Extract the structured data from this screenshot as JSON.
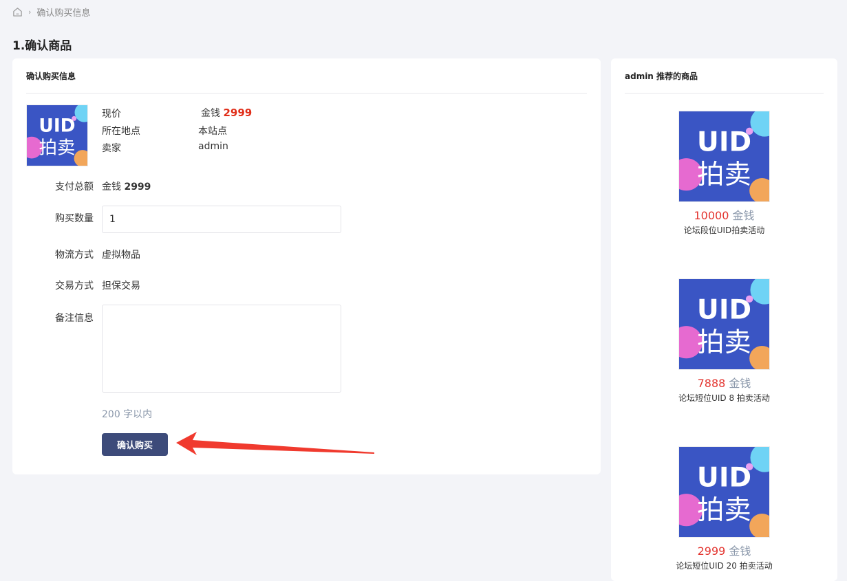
{
  "breadcrumb": {
    "current": "确认购买信息"
  },
  "page_title": "1.确认商品",
  "main": {
    "header": "确认购买信息",
    "item": {
      "image_text_top": "UID",
      "image_text_bottom": "拍卖",
      "price_label": "现价",
      "price_unit": "金钱",
      "price_value": "2999",
      "location_label": "所在地点",
      "location_value": "本站点",
      "seller_label": "卖家",
      "seller_value": "admin"
    },
    "form": {
      "total_label": "支付总额",
      "total_unit": "金钱",
      "total_value": "2999",
      "quantity_label": "购买数量",
      "quantity_value": "1",
      "logistics_label": "物流方式",
      "logistics_value": "虚拟物品",
      "trade_label": "交易方式",
      "trade_value": "担保交易",
      "remark_label": "备注信息",
      "remark_hint": "200 字以内",
      "confirm_label": "确认购买"
    }
  },
  "sidebar": {
    "header": "admin 推荐的商品",
    "items": [
      {
        "price": "10000",
        "unit": "金钱",
        "title": "论坛段位UID拍卖活动"
      },
      {
        "price": "7888",
        "unit": "金钱",
        "title": "论坛短位UID 8 拍卖活动"
      },
      {
        "price": "2999",
        "unit": "金钱",
        "title": "论坛短位UID 20 拍卖活动"
      }
    ]
  },
  "colors": {
    "accent_button": "#3d4b7a",
    "price_red": "#e02d18",
    "annotation_arrow": "#f03a2e"
  }
}
